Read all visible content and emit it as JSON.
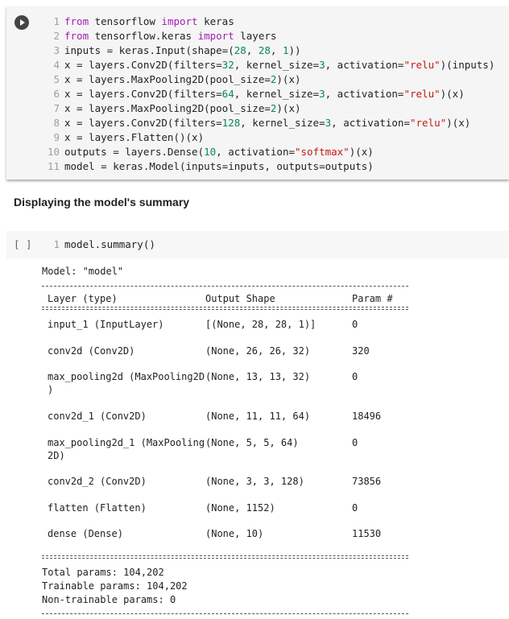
{
  "cell1": {
    "lines": [
      {
        "n": "1",
        "segs": [
          [
            "kw",
            "from"
          ],
          [
            "t",
            " tensorflow "
          ],
          [
            "kw",
            "import"
          ],
          [
            "t",
            " keras"
          ]
        ]
      },
      {
        "n": "2",
        "segs": [
          [
            "kw",
            "from"
          ],
          [
            "t",
            " tensorflow.keras "
          ],
          [
            "kw",
            "import"
          ],
          [
            "t",
            " layers"
          ]
        ]
      },
      {
        "n": "3",
        "segs": [
          [
            "t",
            "inputs = keras.Input(shape=("
          ],
          [
            "num",
            "28"
          ],
          [
            "t",
            ", "
          ],
          [
            "num",
            "28"
          ],
          [
            "t",
            ", "
          ],
          [
            "num",
            "1"
          ],
          [
            "t",
            "))"
          ]
        ]
      },
      {
        "n": "4",
        "segs": [
          [
            "t",
            "x = layers.Conv2D(filters="
          ],
          [
            "num",
            "32"
          ],
          [
            "t",
            ", kernel_size="
          ],
          [
            "num",
            "3"
          ],
          [
            "t",
            ", activation="
          ],
          [
            "str",
            "\"relu\""
          ],
          [
            "t",
            ")(inputs)"
          ]
        ]
      },
      {
        "n": "5",
        "segs": [
          [
            "t",
            "x = layers.MaxPooling2D(pool_size="
          ],
          [
            "num",
            "2"
          ],
          [
            "t",
            ")(x)"
          ]
        ]
      },
      {
        "n": "6",
        "segs": [
          [
            "t",
            "x = layers.Conv2D(filters="
          ],
          [
            "num",
            "64"
          ],
          [
            "t",
            ", kernel_size="
          ],
          [
            "num",
            "3"
          ],
          [
            "t",
            ", activation="
          ],
          [
            "str",
            "\"relu\""
          ],
          [
            "t",
            ")(x)"
          ]
        ]
      },
      {
        "n": "7",
        "segs": [
          [
            "t",
            "x = layers.MaxPooling2D(pool_size="
          ],
          [
            "num",
            "2"
          ],
          [
            "t",
            ")(x)"
          ]
        ]
      },
      {
        "n": "8",
        "segs": [
          [
            "t",
            "x = layers.Conv2D(filters="
          ],
          [
            "num",
            "128"
          ],
          [
            "t",
            ", kernel_size="
          ],
          [
            "num",
            "3"
          ],
          [
            "t",
            ", activation="
          ],
          [
            "str",
            "\"relu\""
          ],
          [
            "t",
            ")(x)"
          ]
        ]
      },
      {
        "n": "9",
        "segs": [
          [
            "t",
            "x = layers.Flatten()(x)"
          ]
        ]
      },
      {
        "n": "10",
        "segs": [
          [
            "t",
            "outputs = layers.Dense("
          ],
          [
            "num",
            "10"
          ],
          [
            "t",
            ", activation="
          ],
          [
            "str",
            "\"softmax\""
          ],
          [
            "t",
            ")(x)"
          ]
        ]
      },
      {
        "n": "11",
        "segs": [
          [
            "t",
            "model = keras.Model(inputs=inputs, outputs=outputs)"
          ]
        ]
      }
    ]
  },
  "heading": "Displaying the model's summary",
  "cell2": {
    "brackets": "[ ]",
    "line_number": "1",
    "code": "model.summary()"
  },
  "output": {
    "model_line": "Model: \"model\"",
    "headers": {
      "layer": "Layer (type)",
      "shape": "Output Shape",
      "params": "Param #"
    },
    "rows": [
      {
        "layer": "input_1 (InputLayer)",
        "shape": "[(None, 28, 28, 1)]",
        "params": "0"
      },
      {
        "layer": "conv2d (Conv2D)",
        "shape": "(None, 26, 26, 32)",
        "params": "320"
      },
      {
        "layer": "max_pooling2d (MaxPooling2D\n)",
        "shape": "(None, 13, 13, 32)",
        "params": "0"
      },
      {
        "layer": "conv2d_1 (Conv2D)",
        "shape": "(None, 11, 11, 64)",
        "params": "18496"
      },
      {
        "layer": "max_pooling2d_1 (MaxPooling\n2D)",
        "shape": "(None, 5, 5, 64)",
        "params": "0"
      },
      {
        "layer": "conv2d_2 (Conv2D)",
        "shape": "(None, 3, 3, 128)",
        "params": "73856"
      },
      {
        "layer": "flatten (Flatten)",
        "shape": "(None, 1152)",
        "params": "0"
      },
      {
        "layer": "dense (Dense)",
        "shape": "(None, 10)",
        "params": "11530"
      }
    ],
    "totals": [
      "Total params: 104,202",
      "Trainable params: 104,202",
      "Non-trainable params: 0"
    ]
  }
}
